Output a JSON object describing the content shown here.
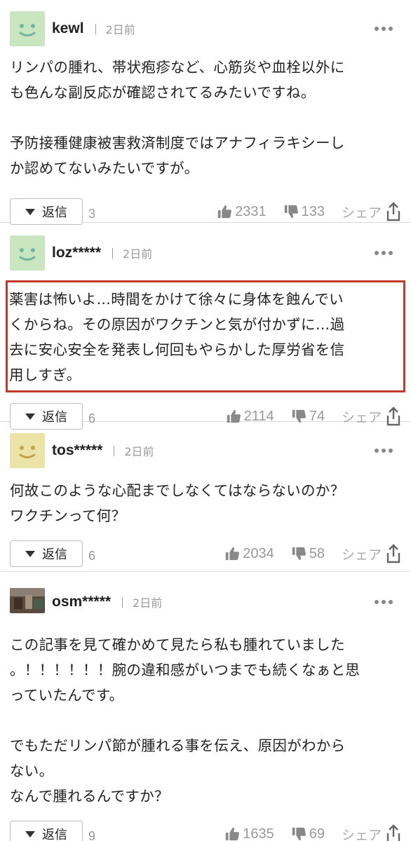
{
  "comments": [
    {
      "user": "kewl",
      "time": "2日前",
      "avatar": "smiley-green",
      "body": "リンパの腫れ、帯状疱疹など、心筋炎や血栓以外に\nも色んな副反応が確認されてるみたいですね。\n\n予防接種健康被害救済制度ではアナフィラキシーし\nか認めてないみたいですが。",
      "reply_label": "返信",
      "reply_count": "3",
      "likes": "2331",
      "dislikes": "133",
      "share_label": "シェア"
    },
    {
      "user": "loz*****",
      "time": "2日前",
      "avatar": "smiley-green",
      "body": "薬害は怖いよ…時間をかけて徐々に身体を蝕んでい\nくからね。その原因がワクチンと気が付かずに…過\n去に安心安全を発表し何回もやらかした厚労省を信\n用しすぎ。",
      "reply_label": "返信",
      "reply_count": "6",
      "likes": "2114",
      "dislikes": "74",
      "share_label": "シェア"
    },
    {
      "user": "tos*****",
      "time": "2日前",
      "avatar": "smiley-yellow",
      "body": "何故このような心配までしなくてはならないのか？\nワクチンって何？",
      "reply_label": "返信",
      "reply_count": "6",
      "likes": "2034",
      "dislikes": "58",
      "share_label": "シェア"
    },
    {
      "user": "osm*****",
      "time": "2日前",
      "avatar": "photo",
      "body": "この記事を見て確かめて見たら私も腫れていました\n。！！！！！！腕の違和感がいつまでも続くなぁと思\nっていたんです。\n\nでもただリンパ節が腫れる事を伝え、原因がわから\nない。\nなんで腫れるんですか？",
      "reply_label": "返信",
      "reply_count": "9",
      "likes": "1635",
      "dislikes": "69",
      "share_label": "シェア"
    }
  ],
  "colors": {
    "highlight_border": "#c0392b",
    "avatar_green_bg": "#c9e6c0",
    "avatar_green_face": "#6fb6a0",
    "avatar_yellow_bg": "#ece3a8",
    "avatar_yellow_face": "#c8a24a",
    "muted_text": "#999999"
  }
}
